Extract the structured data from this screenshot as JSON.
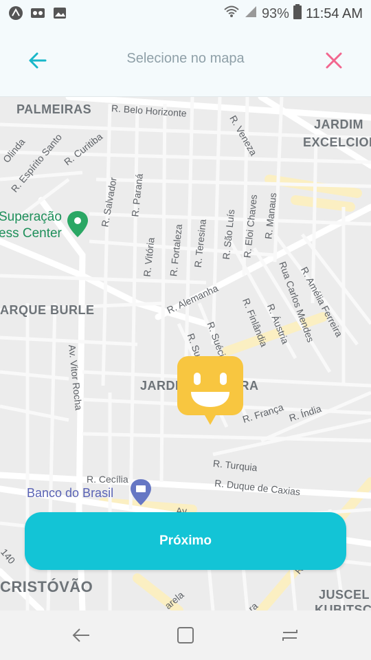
{
  "status_bar": {
    "battery": "93%",
    "time": "11:54 AM",
    "icons_left": [
      "app-a-icon",
      "voicemail-icon",
      "image-icon"
    ],
    "icons_right": [
      "wifi-icon",
      "signal-icon",
      "battery-icon"
    ]
  },
  "header": {
    "title": "Selecione no mapa",
    "back_icon": "arrow-left-icon",
    "close_icon": "close-icon",
    "colors": {
      "back": "#18b7c9",
      "close": "#f2668f"
    }
  },
  "map": {
    "districts": [
      "PALMEIRAS",
      "JARDIM",
      "EXCELCIOR",
      "ARQUE BURLE",
      "JARDI",
      "IRA",
      "CRISTÓVÃO",
      "JUSCEL",
      "KUBITSC"
    ],
    "streets": [
      "R. Belo Horizonte",
      "R. Veneza",
      "Olinda",
      "R. Espírito Santo",
      "R. Curitiba",
      "R. Salvador",
      "R. Paraná",
      "R. Vitória",
      "R. Fortaleza",
      "R. Teresina",
      "R. São Luís",
      "R. Eloi Chaves",
      "R. Manaus",
      "Rua Carlos Mendes",
      "R. Amélia Ferreira",
      "R. Alemanha",
      "R. Finlândia",
      "R. Áustria",
      "R. Suécia",
      "R. Suíç",
      "Av. Vitor Rocha",
      "R. França",
      "R. Índia",
      "R. Turquia",
      "R. Duque de Caxias",
      "R. Cecília",
      "Av",
      "140",
      "R",
      "arela",
      "ra"
    ],
    "pois": [
      "Superação",
      "ess Center",
      "Banco do Brasil"
    ]
  },
  "pin": {
    "icon": "smiley-pin-icon",
    "color": "#f8c640"
  },
  "next_button": {
    "label": "Próximo",
    "color": "#13c4d6"
  },
  "nav_bar": {
    "icons": [
      "back-nav-icon",
      "home-nav-icon",
      "recents-nav-icon"
    ]
  }
}
